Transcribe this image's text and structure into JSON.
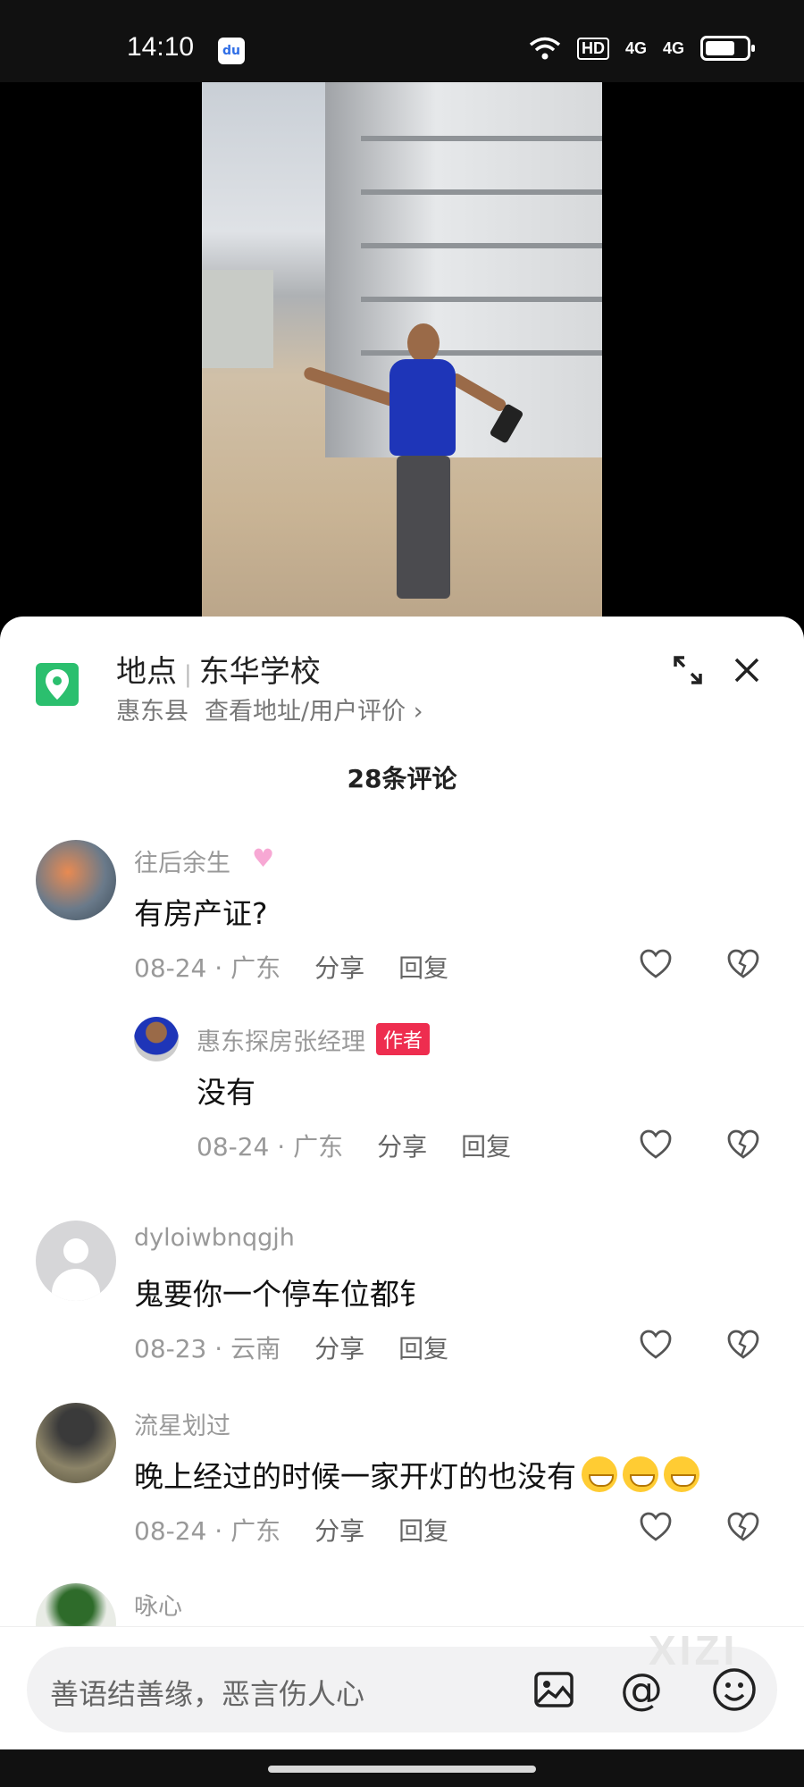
{
  "status_bar": {
    "time": "14:10",
    "baidu_icon": "du",
    "hd_label": "HD",
    "net1": "4G",
    "net2": "4G"
  },
  "location": {
    "label": "地点",
    "name": "东华学校",
    "county": "惠东县",
    "link": "查看地址/用户评价"
  },
  "comments_count": "28条评论",
  "comments": [
    {
      "name": "往后余生",
      "text": "有房产证?",
      "date": "08-24 · 广东",
      "share": "分享",
      "reply": "回复"
    },
    {
      "name": "惠东探房张经理",
      "badge": "作者",
      "text": "没有",
      "date": "08-24 · 广东",
      "share": "分享",
      "reply": "回复"
    },
    {
      "name": "dyloiwbnqgjh",
      "text": "鬼要你一个停车位都钅",
      "date": "08-23 · 云南",
      "share": "分享",
      "reply": "回复"
    },
    {
      "name": "流星划过",
      "text": "晚上经过的时候一家开灯的也没有",
      "date": "08-24 · 广东",
      "share": "分享",
      "reply": "回复"
    },
    {
      "name": "咏心"
    }
  ],
  "input": {
    "placeholder": "善语结善缘，恶言伤人心",
    "at": "@"
  },
  "watermark": "XIZI",
  "colors": {
    "accent_red": "#ee2d4f",
    "location_green": "#2bbf6e"
  }
}
